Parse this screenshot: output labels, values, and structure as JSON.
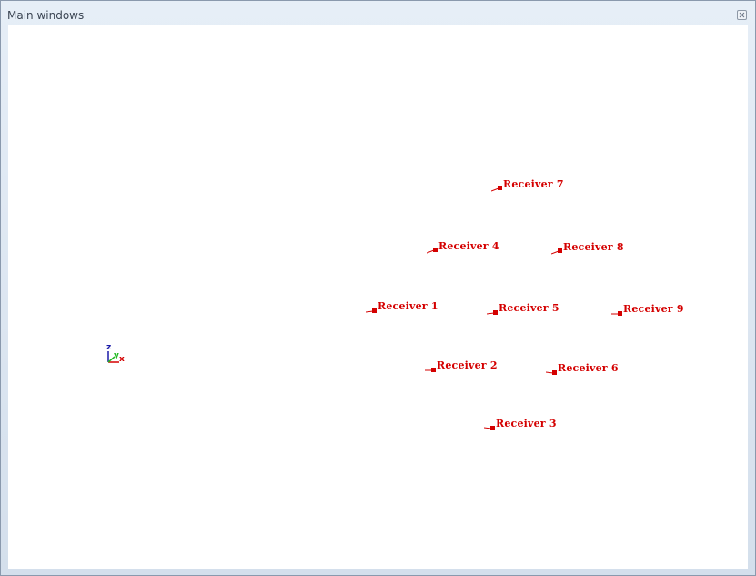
{
  "window": {
    "title": "Main windows",
    "close_icon": "close-icon"
  },
  "colors": {
    "receiver": "#d40000",
    "axis_x": "#d40000",
    "axis_y": "#22bb22",
    "axis_z": "#1a1aa8"
  },
  "axis_triad": {
    "x": "x",
    "y": "y",
    "z": "z"
  },
  "receivers": [
    {
      "label": "Receiver 1"
    },
    {
      "label": "Receiver 2"
    },
    {
      "label": "Receiver 3"
    },
    {
      "label": "Receiver 4"
    },
    {
      "label": "Receiver 5"
    },
    {
      "label": "Receiver 6"
    },
    {
      "label": "Receiver 7"
    },
    {
      "label": "Receiver 8"
    },
    {
      "label": "Receiver 9"
    }
  ]
}
